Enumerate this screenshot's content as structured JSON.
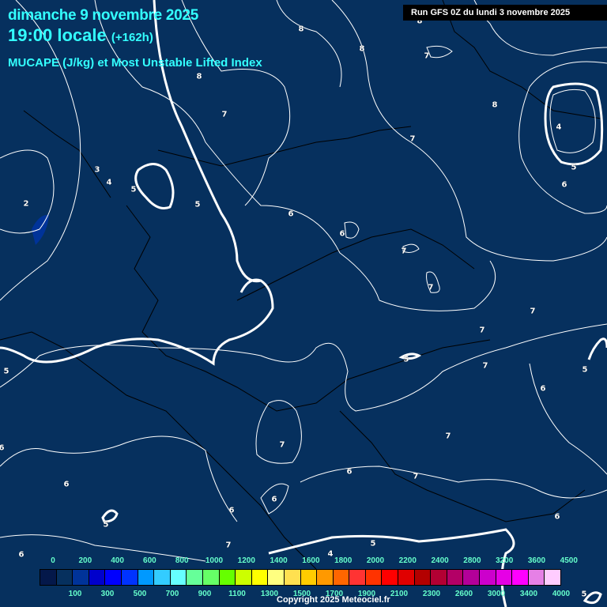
{
  "header": {
    "date": "dimanche 9 novembre 2025",
    "time": "19:00 locale",
    "lead": "(+162h)",
    "parameter": "MUCAPE (J/kg) et Most Unstable Lifted Index",
    "run": "Run GFS 0Z du lundi 3 novembre 2025"
  },
  "map": {
    "background_color": "#06305e",
    "contour_labels": [
      "8",
      "8",
      "8",
      "7",
      "8",
      "7",
      "7",
      "8",
      "4",
      "5",
      "6",
      "3",
      "4",
      "5",
      "5",
      "2",
      "6",
      "6",
      "7",
      "7",
      "7",
      "7",
      "5",
      "5",
      "7",
      "6",
      "7",
      "6",
      "7",
      "7",
      "6",
      "6",
      "6",
      "5",
      "7",
      "5",
      "4",
      "5",
      "6",
      "6",
      "6",
      "5"
    ]
  },
  "legend": {
    "top_labels": [
      "0",
      "200",
      "400",
      "600",
      "800",
      "1000",
      "1200",
      "1400",
      "1600",
      "1800",
      "2000",
      "2200",
      "2400",
      "2800",
      "3200",
      "3600",
      "4500"
    ],
    "bottom_labels": [
      "100",
      "300",
      "500",
      "700",
      "900",
      "1100",
      "1300",
      "1500",
      "1700",
      "1900",
      "2100",
      "2300",
      "2600",
      "3000",
      "3400",
      "4000"
    ],
    "colors": [
      "#04184a",
      "#06305e",
      "#003399",
      "#0000cc",
      "#0000ff",
      "#0033ff",
      "#0099ff",
      "#33ccff",
      "#66ffff",
      "#66ff99",
      "#66ff66",
      "#66ff00",
      "#ccff00",
      "#ffff00",
      "#ffff80",
      "#ffe050",
      "#ffcc00",
      "#ff9900",
      "#ff6600",
      "#ff3333",
      "#ff3300",
      "#ff0000",
      "#e00000",
      "#b30000",
      "#b30033",
      "#b30066",
      "#b30099",
      "#cc00cc",
      "#e600e6",
      "#ff00ff",
      "#e680e6",
      "#ffccff",
      "#ffffff"
    ]
  },
  "footer": {
    "copyright": "Copyright 2025 Meteociel.fr"
  }
}
